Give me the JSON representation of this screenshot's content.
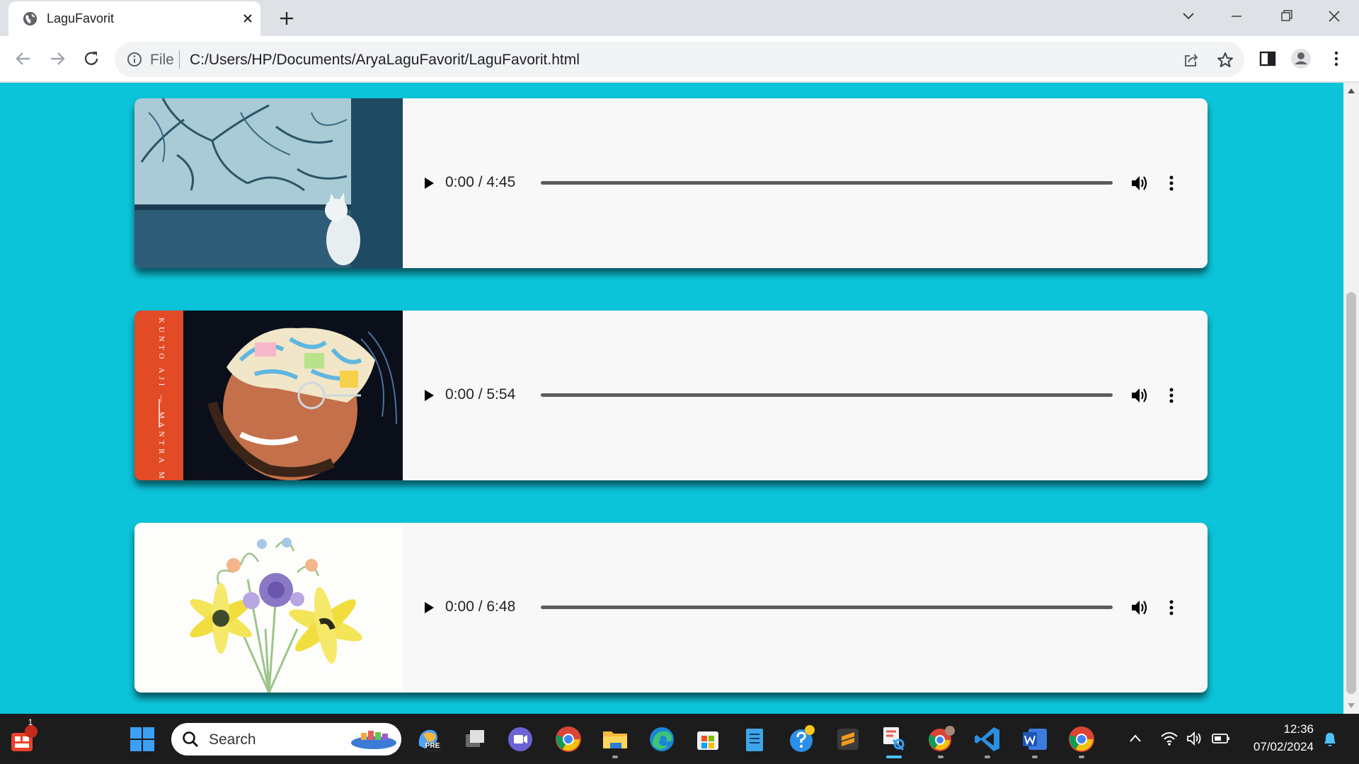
{
  "browser": {
    "tab_title": "LaguFavorit",
    "address_scheme": "File",
    "address_url": "C:/Users/HP/Documents/AryaLaguFavorit/LaguFavorit.html"
  },
  "songs": [
    {
      "time": "0:00 / 4:45",
      "cover": "window-cat-cover",
      "progress": 0
    },
    {
      "time": "0:00 / 5:54",
      "cover": "kunto-aji-mantra-mantra-cover",
      "progress": 0,
      "cover_text": "KUNTO AJI — MANTRA MANTRA"
    },
    {
      "time": "0:00 / 6:48",
      "cover": "flower-bouquet-cover",
      "progress": 0
    }
  ],
  "taskbar": {
    "search_placeholder": "Search",
    "widget_badge": "1",
    "time": "12:36",
    "date": "07/02/2024"
  },
  "colors": {
    "page_background": "#0cc4d9",
    "card_background": "#f8f8f8",
    "taskbar": "#1c1c1c",
    "chrome_frame": "#dee1e6"
  }
}
